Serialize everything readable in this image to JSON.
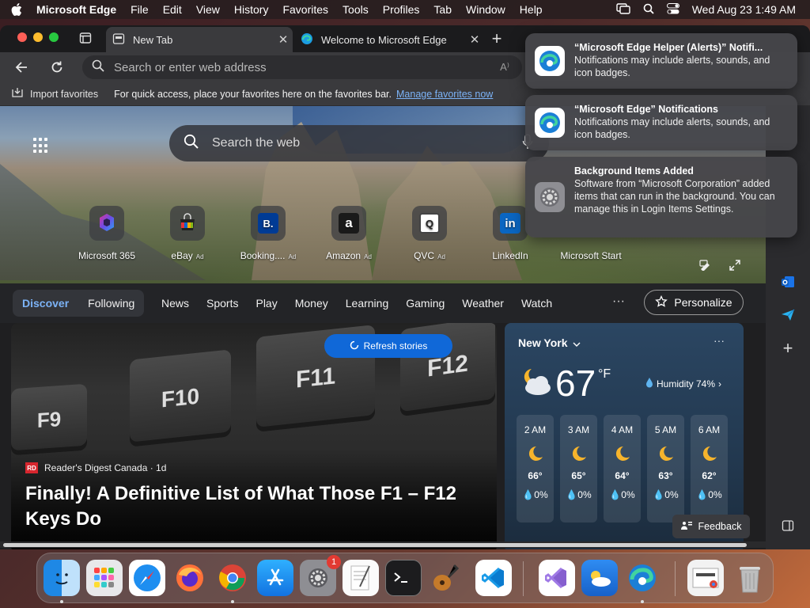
{
  "menubar": {
    "app_name": "Microsoft Edge",
    "items": [
      "File",
      "Edit",
      "View",
      "History",
      "Favorites",
      "Tools",
      "Profiles",
      "Tab",
      "Window",
      "Help"
    ],
    "datetime": "Wed Aug 23  1:49 AM"
  },
  "tabs": [
    {
      "label": "New Tab",
      "active": true
    },
    {
      "label": "Welcome to Microsoft Edge",
      "active": false
    }
  ],
  "address": {
    "placeholder": "Search or enter web address"
  },
  "favorites_bar": {
    "import_label": "Import favorites",
    "message": "For quick access, place your favorites here on the favorites bar.",
    "link": "Manage favorites now"
  },
  "hero": {
    "search_placeholder": "Search the web",
    "quick_links": [
      {
        "label": "Microsoft 365",
        "ad": "",
        "icon": "microsoft-365-icon",
        "color": "#5b5fc7",
        "glyph": ""
      },
      {
        "label": "eBay",
        "ad": "Ad",
        "icon": "ebay-icon",
        "color": "#222222",
        "glyph": ""
      },
      {
        "label": "Booking....",
        "ad": "Ad",
        "icon": "booking-icon",
        "color": "#003b95",
        "glyph": "B."
      },
      {
        "label": "Amazon",
        "ad": "Ad",
        "icon": "amazon-icon",
        "color": "#1a1a1a",
        "glyph": "a"
      },
      {
        "label": "QVC",
        "ad": "Ad",
        "icon": "qvc-icon",
        "color": "#ffffff",
        "glyph": "Q"
      },
      {
        "label": "LinkedIn",
        "ad": "",
        "icon": "linkedin-icon",
        "color": "#0a66c2",
        "glyph": "in"
      },
      {
        "label": "Microsoft Start",
        "ad": "",
        "icon": "microsoft-start-icon",
        "color": "#444444",
        "glyph": ""
      }
    ]
  },
  "discover": {
    "discover_label": "Discover",
    "following_label": "Following",
    "links": [
      "News",
      "Sports",
      "Play",
      "Money",
      "Learning",
      "Gaming",
      "Weather",
      "Watch"
    ],
    "more": "···",
    "personalize_label": "Personalize"
  },
  "feed": {
    "refresh_label": "Refresh stories",
    "source": "Reader's Digest Canada · 1d",
    "source_logo": "RD",
    "headline": "Finally! A Definitive List of What Those F1 – F12 Keys Do",
    "keys": [
      "F9",
      "F10",
      "F11",
      "F12"
    ]
  },
  "weather": {
    "city": "New York",
    "more": "···",
    "temperature": "67",
    "unit": "°F",
    "humidity": "Humidity 74%",
    "hours": [
      {
        "time": "2 AM",
        "temp": "66°",
        "precip": "0%"
      },
      {
        "time": "3 AM",
        "temp": "65°",
        "precip": "0%"
      },
      {
        "time": "4 AM",
        "temp": "64°",
        "precip": "0%"
      },
      {
        "time": "5 AM",
        "temp": "63°",
        "precip": "0%"
      },
      {
        "time": "6 AM",
        "temp": "62°",
        "precip": "0%"
      }
    ]
  },
  "feedback_label": "Feedback",
  "notifications": [
    {
      "title": "“Microsoft Edge Helper (Alerts)” Notifi...",
      "body": "Notifications may include alerts, sounds, and icon badges."
    },
    {
      "title": "“Microsoft Edge” Notifications",
      "body": "Notifications may include alerts, sounds, and icon badges."
    },
    {
      "title": "Background Items Added",
      "body": "Software from “Microsoft Corporation” added items that can run in the background. You can manage this in Login Items Settings."
    }
  ],
  "dock": {
    "items": [
      "finder-icon",
      "launchpad-icon",
      "safari-icon",
      "firefox-icon",
      "chrome-icon",
      "app-store-icon",
      "system-settings-icon",
      "textedit-icon",
      "terminal-icon",
      "garageband-icon",
      "vscode-icon",
      "visual-studio-icon",
      "weather-app-icon",
      "edge-icon",
      "preview-icon",
      "trash-icon"
    ],
    "settings_badge": "1"
  },
  "colors": {
    "accent": "#1068d8",
    "link": "#7cb3f7",
    "badge": "#e23a32"
  }
}
